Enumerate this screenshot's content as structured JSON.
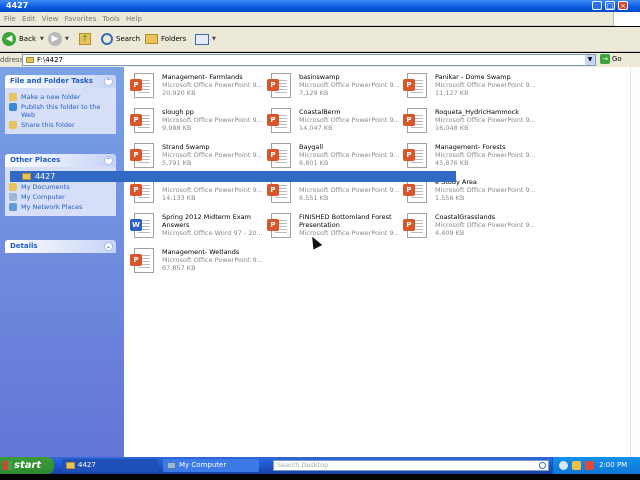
{
  "window": {
    "title": "4427",
    "controls": {
      "minimize": "_",
      "maximize": "□",
      "close": "×"
    }
  },
  "menu": [
    "File",
    "Edit",
    "View",
    "Favorites",
    "Tools",
    "Help"
  ],
  "toolbar": {
    "back_label": "Back",
    "search_label": "Search",
    "folders_label": "Folders"
  },
  "address": {
    "label": "ddress",
    "value": "F:\\4427",
    "go_label": "Go"
  },
  "tasks_panel": {
    "title": "File and Folder Tasks",
    "items": [
      "Make a new folder",
      "Publish this folder to the Web",
      "Share this folder"
    ]
  },
  "other_places": {
    "title": "Other Places",
    "items": [
      "My Documents",
      "My Computer",
      "My Network Places"
    ]
  },
  "selected_item": "4427",
  "details_panel": {
    "title": "Details"
  },
  "files": [
    {
      "name": "Management- Farmlands",
      "type": "Microsoft Office PowerPoint 9...",
      "size": "20,920 KB",
      "kind": "ppt"
    },
    {
      "name": "basinswamp",
      "type": "Microsoft Office PowerPoint 9...",
      "size": "7,129 KB",
      "kind": "ppt"
    },
    {
      "name": "Panikar - Dome Swamp",
      "type": "Microsoft Office PowerPoint 9...",
      "size": "11,127 KB",
      "kind": "ppt"
    },
    {
      "name": "slough pp",
      "type": "Microsoft Office PowerPoint 9...",
      "size": "9,988 KB",
      "kind": "ppt"
    },
    {
      "name": "CoastalBerm",
      "type": "Microsoft Office PowerPoint 9...",
      "size": "14,047 KB",
      "kind": "ppt"
    },
    {
      "name": "Roqueta_HydricHammock",
      "type": "Microsoft Office PowerPoint 9...",
      "size": "16,048 KB",
      "kind": "ppt"
    },
    {
      "name": "Strand Swamp",
      "type": "Microsoft Office PowerPoint 9...",
      "size": "5,791 KB",
      "kind": "ppt"
    },
    {
      "name": "Baygall",
      "type": "Microsoft Office PowerPoint 9...",
      "size": "6,801 KB",
      "kind": "ppt"
    },
    {
      "name": "Management- Forests",
      "type": "Microsoft Office PowerPoint 9...",
      "size": "45,876 KB",
      "kind": "ppt"
    },
    {
      "name": "",
      "type": "Microsoft Office PowerPoint 9...",
      "size": "14,133 KB",
      "kind": "ppt"
    },
    {
      "name": "",
      "type": "Microsoft Office PowerPoint 9...",
      "size": "6,551 KB",
      "kind": "ppt"
    },
    {
      "name": "e Study Area",
      "type": "Microsoft Office PowerPoint 9...",
      "size": "1,556 KB",
      "kind": "ppt"
    },
    {
      "name": "Spring 2012 Midterm Exam Answers",
      "type": "Microsoft Office Word 97 - 20...",
      "size": "",
      "kind": "doc"
    },
    {
      "name": "FINISHED Bottomland Forest Presentation",
      "type": "Microsoft Office PowerPoint 9...",
      "size": "",
      "kind": "ppt"
    },
    {
      "name": "CoastalGrasslands",
      "type": "Microsoft Office PowerPoint 9...",
      "size": "4,409 KB",
      "kind": "ppt"
    },
    {
      "name": "Management- Wetlands",
      "type": "Microsoft Office PowerPoint 9...",
      "size": "67,857 KB",
      "kind": "ppt"
    }
  ],
  "taskbar": {
    "start_label": "start",
    "tasks": [
      "4427",
      "My Computer"
    ],
    "search_placeholder": "Search Desktop",
    "clock": "2:00 PM"
  }
}
